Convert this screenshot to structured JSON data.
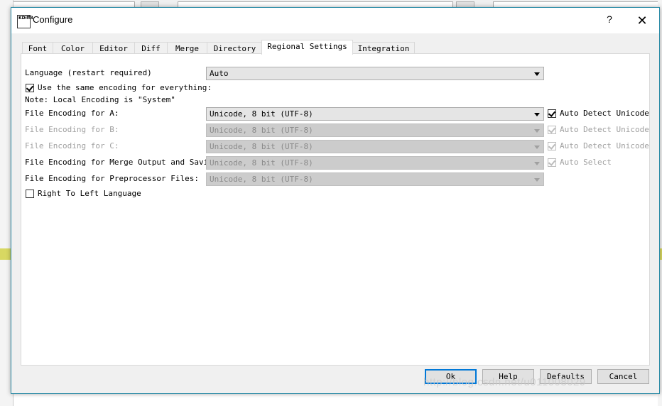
{
  "dialog": {
    "title": "Configure",
    "help_symbol": "?",
    "close_symbol": "✕",
    "icon_text": "KDiff3"
  },
  "tabs": [
    {
      "label": "Font"
    },
    {
      "label": "Color"
    },
    {
      "label": "Editor"
    },
    {
      "label": "Diff"
    },
    {
      "label": "Merge"
    },
    {
      "label": "Directory"
    },
    {
      "label": "Regional Settings"
    },
    {
      "label": "Integration"
    }
  ],
  "active_tab": "Regional Settings",
  "regional": {
    "language_label": "Language (restart required)",
    "language_value": "Auto",
    "same_encoding_label": "Use the same encoding for everything:",
    "same_encoding_checked": true,
    "note": "Note: Local Encoding is \"System\"",
    "rows": [
      {
        "label": "File Encoding for A:",
        "value": "Unicode, 8 bit (UTF-8)",
        "enabled": true,
        "detect_label": "Auto Detect Unicode",
        "detect_checked": true
      },
      {
        "label": "File Encoding for B:",
        "value": "Unicode, 8 bit (UTF-8)",
        "enabled": false,
        "detect_label": "Auto Detect Unicode",
        "detect_checked": true
      },
      {
        "label": "File Encoding for C:",
        "value": "Unicode, 8 bit (UTF-8)",
        "enabled": false,
        "detect_label": "Auto Detect Unicode",
        "detect_checked": true
      },
      {
        "label": "File Encoding for Merge Output and Saving:",
        "value": "Unicode, 8 bit (UTF-8)",
        "enabled": false,
        "detect_label": "Auto Select",
        "detect_checked": true
      },
      {
        "label": "File Encoding for Preprocessor Files:",
        "value": "Unicode, 8 bit (UTF-8)",
        "enabled": false
      }
    ],
    "rtl_label": "Right To Left Language",
    "rtl_checked": false
  },
  "buttons": {
    "ok": "Ok",
    "help": "Help",
    "defaults": "Defaults",
    "cancel": "Cancel"
  },
  "watermark": "http://blog.csdn.net/u011008029",
  "colors": {
    "dialog_border": "#2b8ba6",
    "default_button_border": "#0078d7",
    "background_band": "#d8d862"
  }
}
